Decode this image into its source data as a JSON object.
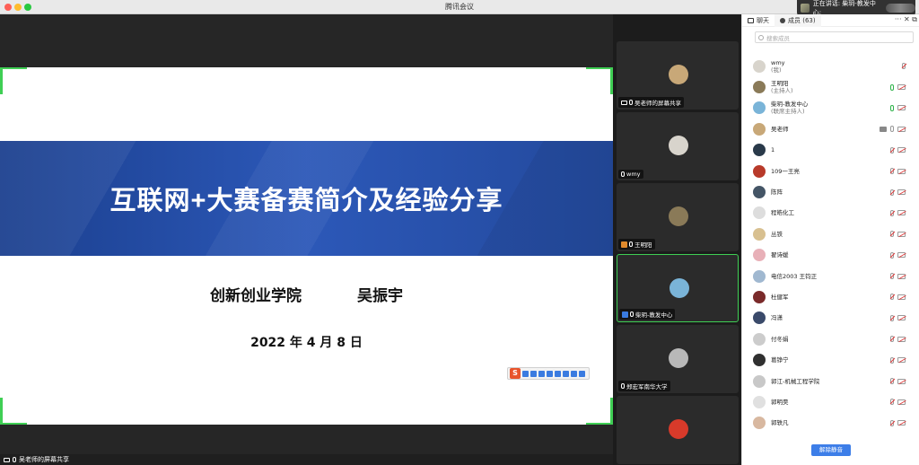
{
  "window": {
    "title": "腾讯会议"
  },
  "speaking_banner": {
    "text": "正在讲话: 柴玥-教发中心;"
  },
  "slide": {
    "title": "互联网+大赛备赛简介及经验分享",
    "org": "创新创业学院",
    "author": "吴振宇",
    "date": "2022 年 4 月 8 日",
    "ime_logo": "S"
  },
  "share_label": "吴老师的屏幕共享",
  "video_tiles": [
    {
      "label": "吴老师的屏幕共享",
      "color": "#c8a878",
      "active": false
    },
    {
      "label": "wmy",
      "color": "#d8d4cc",
      "active": false
    },
    {
      "label": "王明阳",
      "color": "#8a7a58",
      "active": false
    },
    {
      "label": "柴玥-教发中心",
      "color": "#7ab4d8",
      "active": true
    },
    {
      "label": "郑宏军南华大学",
      "color": "#b8b8b8",
      "active": false
    },
    {
      "label": "",
      "color": "#d83a2a",
      "active": false
    }
  ],
  "panel": {
    "tab_chat": "聊天",
    "tab_members": "成员 (63)",
    "tools": "··· ✕ ⧉",
    "search_placeholder": "搜索成员",
    "members": [
      {
        "name": "wmy",
        "role": "(我)",
        "color": "#d8d4cc",
        "mic": "red-only"
      },
      {
        "name": "王明阳",
        "role": "(主持人)",
        "color": "#8a7a58",
        "mic": "green"
      },
      {
        "name": "柴玥-教发中心",
        "role": "(联席主持人)",
        "color": "#7ab4d8",
        "mic": "green"
      },
      {
        "name": "吴老师",
        "role": "",
        "color": "#c8a878",
        "mic": "share"
      },
      {
        "name": "1",
        "role": "",
        "color": "#2a3a4a",
        "mic": "red"
      },
      {
        "name": "109一王亮",
        "role": "",
        "color": "#b83a2a",
        "mic": "red"
      },
      {
        "name": "陈阵",
        "role": "",
        "color": "#445566",
        "mic": "red"
      },
      {
        "name": "程皓化工",
        "role": "",
        "color": "#dddddd",
        "mic": "red"
      },
      {
        "name": "丛铁",
        "role": "",
        "color": "#d8c090",
        "mic": "red"
      },
      {
        "name": "翟诗媛",
        "role": "",
        "color": "#e8b0b8",
        "mic": "red"
      },
      {
        "name": "电信2003 王钧正",
        "role": "",
        "color": "#a0b8d0",
        "mic": "red"
      },
      {
        "name": "杜健军",
        "role": "",
        "color": "#7a2a2a",
        "mic": "red"
      },
      {
        "name": "冯潇",
        "role": "",
        "color": "#3a4a6a",
        "mic": "red"
      },
      {
        "name": "付冬娟",
        "role": "",
        "color": "#cccccc",
        "mic": "red"
      },
      {
        "name": "葛铮宁",
        "role": "",
        "color": "#303030",
        "mic": "red"
      },
      {
        "name": "郭江-机械工程学院",
        "role": "",
        "color": "#c8c8c8",
        "mic": "red"
      },
      {
        "name": "郭明昊",
        "role": "",
        "color": "#e0e0e0",
        "mic": "red"
      },
      {
        "name": "郭轶凡",
        "role": "",
        "color": "#d8b8a0",
        "mic": "red"
      }
    ],
    "unmute_button": "解除静音"
  }
}
